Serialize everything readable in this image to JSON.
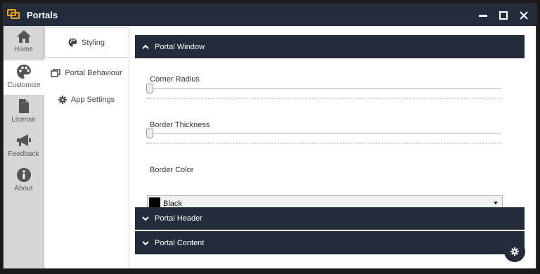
{
  "app": {
    "title": "Portals"
  },
  "colors": {
    "titlebar": "#222c3a",
    "accent": "#f7a51c",
    "section": "#222c3a"
  },
  "rail": {
    "items": [
      {
        "label": "Home",
        "icon": "home-icon"
      },
      {
        "label": "Customize",
        "icon": "palette-icon",
        "active": true
      },
      {
        "label": "License",
        "icon": "document-icon"
      },
      {
        "label": "Feedback",
        "icon": "megaphone-icon"
      },
      {
        "label": "About",
        "icon": "info-icon"
      }
    ]
  },
  "subnav": {
    "items": [
      {
        "label": "Styling",
        "icon": "palette-icon",
        "active": true
      },
      {
        "label": "Portal Behaviour",
        "icon": "windows-icon"
      },
      {
        "label": "App Settings",
        "icon": "gear-icon"
      }
    ]
  },
  "content": {
    "sections": [
      {
        "title": "Portal Window",
        "expanded": true
      },
      {
        "title": "Portal Header",
        "expanded": false
      },
      {
        "title": "Portal Content",
        "expanded": false
      }
    ],
    "corner_radius": {
      "label": "Corner Radius",
      "value": 0
    },
    "border_thickness": {
      "label": "Border Thickness",
      "value": 0
    },
    "border_color": {
      "label": "Border Color",
      "value": "Black",
      "swatch": "#000000"
    }
  }
}
